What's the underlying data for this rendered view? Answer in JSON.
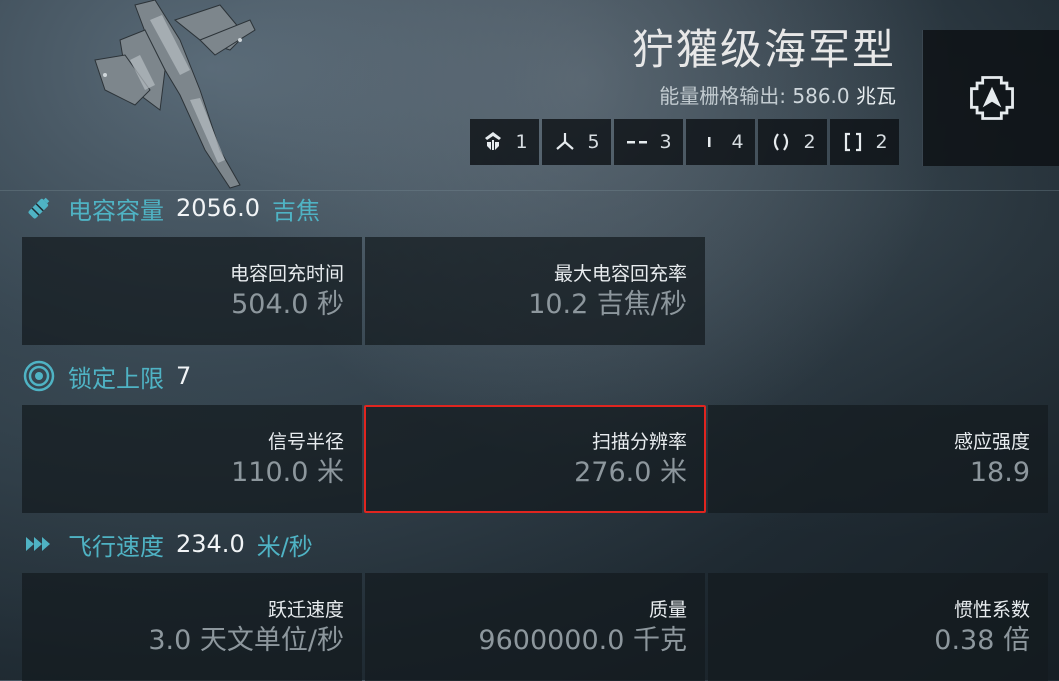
{
  "ship": {
    "name": "狞獾级海军型",
    "powergrid_label": "能量栅格输出:",
    "powergrid_value": "586.0",
    "powergrid_unit": "兆瓦"
  },
  "slots": [
    {
      "icon": "turret-hardpoint-icon",
      "count": "1"
    },
    {
      "icon": "launcher-hardpoint-icon",
      "count": "5"
    },
    {
      "icon": "high-slot-icon",
      "count": "3"
    },
    {
      "icon": "mid-slot-icon",
      "count": "4"
    },
    {
      "icon": "low-slot-icon",
      "count": "2"
    },
    {
      "icon": "rig-slot-icon",
      "count": "2"
    }
  ],
  "sections": {
    "capacitor": {
      "label": "电容容量",
      "value": "2056.0",
      "unit": "吉焦",
      "cells": [
        {
          "label": "电容回充时间",
          "value": "504.0 秒"
        },
        {
          "label": "最大电容回充率",
          "value": "10.2 吉焦/秒"
        }
      ]
    },
    "targeting": {
      "label": "锁定上限",
      "value": "7",
      "unit": "",
      "cells": [
        {
          "label": "信号半径",
          "value": "110.0 米"
        },
        {
          "label": "扫描分辨率",
          "value": "276.0 米"
        },
        {
          "label": "感应强度",
          "value": "18.9"
        }
      ]
    },
    "navigation": {
      "label": "飞行速度",
      "value": "234.0",
      "unit": "米/秒",
      "cells": [
        {
          "label": "跃迁速度",
          "value": "3.0 天文单位/秒"
        },
        {
          "label": "质量",
          "value": "9600000.0 千克"
        },
        {
          "label": "惯性系数",
          "value": "0.38 倍"
        }
      ]
    }
  },
  "colors": {
    "accent": "#4fb3c4",
    "highlight": "#e0251f",
    "value_dim": "#8d979d"
  }
}
